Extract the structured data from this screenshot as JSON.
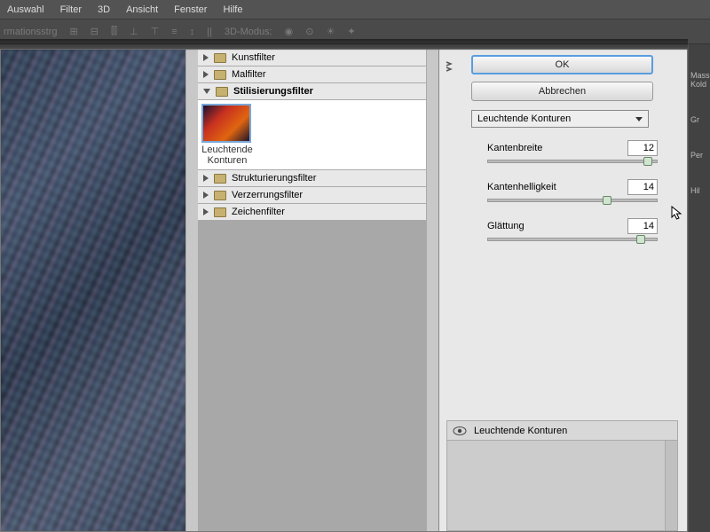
{
  "menubar": [
    "Auswahl",
    "Filter",
    "3D",
    "Ansicht",
    "Fenster",
    "Hilfe"
  ],
  "toolbar": {
    "label_left": "rmationsstrg",
    "label_right": "3D-Modus:"
  },
  "tree": {
    "items": [
      {
        "label": "Kunstfilter",
        "expanded": false
      },
      {
        "label": "Malfilter",
        "expanded": false
      },
      {
        "label": "Stilisierungsfilter",
        "expanded": true,
        "selected": true
      },
      {
        "label": "Strukturierungsfilter",
        "expanded": false
      },
      {
        "label": "Verzerrungsfilter",
        "expanded": false
      },
      {
        "label": "Zeichenfilter",
        "expanded": false
      }
    ],
    "thumb_label": "Leuchtende Konturen"
  },
  "controls": {
    "ok": "OK",
    "cancel": "Abbrechen",
    "preset": "Leuchtende Konturen",
    "sliders": [
      {
        "label": "Kantenbreite",
        "value": "12",
        "pos": 92
      },
      {
        "label": "Kantenhelligkeit",
        "value": "14",
        "pos": 68
      },
      {
        "label": "Glättung",
        "value": "14",
        "pos": 88
      }
    ]
  },
  "layers": {
    "active": "Leuchtende Konturen"
  },
  "right_labels": [
    "Masse Kold",
    "Gr",
    "Per",
    "Hil"
  ]
}
